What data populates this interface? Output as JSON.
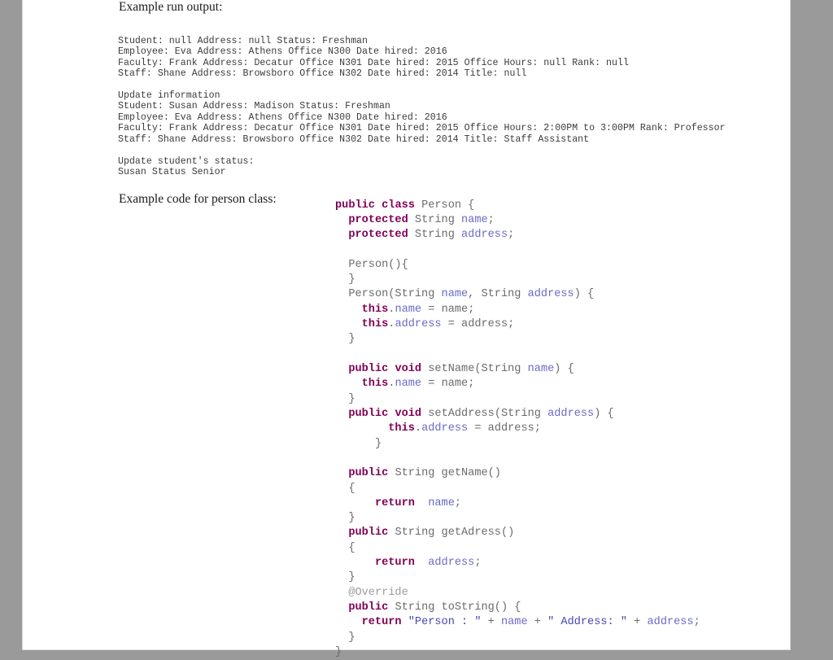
{
  "document": {
    "background_color": "#9a9a9a",
    "page_color": "#ffffff"
  },
  "headings": {
    "run_output": "Example run output:",
    "code": "Example code for person class:"
  },
  "run_output": {
    "lines": [
      "Student: null Address: null Status: Freshman",
      "Employee: Eva Address: Athens Office N300 Date hired: 2016",
      "Faculty: Frank Address: Decatur Office N301 Date hired: 2015 Office Hours: null Rank: null",
      "Staff: Shane Address: Browsboro Office N302 Date hired: 2014 Title: null",
      "",
      "Update information",
      "Student: Susan Address: Madison Status: Freshman",
      "Employee: Eva Address: Athens Office N300 Date hired: 2016",
      "Faculty: Frank Address: Decatur Office N301 Date hired: 2015 Office Hours: 2:00PM to 3:00PM Rank: Professor",
      "Staff: Shane Address: Browsboro Office N302 Date hired: 2014 Title: Staff Assistant",
      "",
      "Update student's status:",
      "Susan Status Senior"
    ]
  },
  "code": {
    "language": "java",
    "class_name": "Person",
    "plain_text": "public class Person {\n  protected String name;\n  protected String address;\n\n  Person(){\n  }\n  Person(String name, String address) {\n    this.name = name;\n    this.address = address;\n  }\n\n  public void setName(String name) {\n    this.name = name;\n  }\n  public void setAddress(String address) {\n        this.address = address;\n      }\n\n  public String getName()\n  {\n      return  name;\n  }\n  public String getAdress()\n  {\n      return  address;\n  }\n  @Override\n  public String toString() {\n    return \"Person : \" + name + \" Address: \" + address;\n  }\n}",
    "colors": {
      "keyword": "#7f0055",
      "field": "#6a6ac6",
      "string": "#4646b4",
      "annotation": "#9d9d9d",
      "plain": "#6b6b6b"
    },
    "lines": [
      [
        {
          "t": "public",
          "c": "kw"
        },
        {
          "t": " ",
          "c": "pln"
        },
        {
          "t": "class",
          "c": "kw"
        },
        {
          "t": " Person {",
          "c": "pln"
        }
      ],
      [
        {
          "t": "  ",
          "c": "pln"
        },
        {
          "t": "protected",
          "c": "kw"
        },
        {
          "t": " String ",
          "c": "pln"
        },
        {
          "t": "name",
          "c": "fld"
        },
        {
          "t": ";",
          "c": "pln"
        }
      ],
      [
        {
          "t": "  ",
          "c": "pln"
        },
        {
          "t": "protected",
          "c": "kw"
        },
        {
          "t": " String ",
          "c": "pln"
        },
        {
          "t": "address",
          "c": "fld"
        },
        {
          "t": ";",
          "c": "pln"
        }
      ],
      [],
      [
        {
          "t": "  Person(){",
          "c": "pln"
        }
      ],
      [
        {
          "t": "  }",
          "c": "pln"
        }
      ],
      [
        {
          "t": "  Person(String ",
          "c": "pln"
        },
        {
          "t": "name",
          "c": "fld"
        },
        {
          "t": ", String ",
          "c": "pln"
        },
        {
          "t": "address",
          "c": "fld"
        },
        {
          "t": ") {",
          "c": "pln"
        }
      ],
      [
        {
          "t": "    ",
          "c": "pln"
        },
        {
          "t": "this",
          "c": "kw"
        },
        {
          "t": ".",
          "c": "pln"
        },
        {
          "t": "name",
          "c": "fld"
        },
        {
          "t": " = name;",
          "c": "pln"
        }
      ],
      [
        {
          "t": "    ",
          "c": "pln"
        },
        {
          "t": "this",
          "c": "kw"
        },
        {
          "t": ".",
          "c": "pln"
        },
        {
          "t": "address",
          "c": "fld"
        },
        {
          "t": " = address;",
          "c": "pln"
        }
      ],
      [
        {
          "t": "  }",
          "c": "pln"
        }
      ],
      [],
      [
        {
          "t": "  ",
          "c": "pln"
        },
        {
          "t": "public",
          "c": "kw"
        },
        {
          "t": " ",
          "c": "pln"
        },
        {
          "t": "void",
          "c": "kw"
        },
        {
          "t": " setName(String ",
          "c": "pln"
        },
        {
          "t": "name",
          "c": "fld"
        },
        {
          "t": ") {",
          "c": "pln"
        }
      ],
      [
        {
          "t": "    ",
          "c": "pln"
        },
        {
          "t": "this",
          "c": "kw"
        },
        {
          "t": ".",
          "c": "pln"
        },
        {
          "t": "name",
          "c": "fld"
        },
        {
          "t": " = name;",
          "c": "pln"
        }
      ],
      [
        {
          "t": "  }",
          "c": "pln"
        }
      ],
      [
        {
          "t": "  ",
          "c": "pln"
        },
        {
          "t": "public",
          "c": "kw"
        },
        {
          "t": " ",
          "c": "pln"
        },
        {
          "t": "void",
          "c": "kw"
        },
        {
          "t": " setAddress(String ",
          "c": "pln"
        },
        {
          "t": "address",
          "c": "fld"
        },
        {
          "t": ") {",
          "c": "pln"
        }
      ],
      [
        {
          "t": "        ",
          "c": "pln"
        },
        {
          "t": "this",
          "c": "kw"
        },
        {
          "t": ".",
          "c": "pln"
        },
        {
          "t": "address",
          "c": "fld"
        },
        {
          "t": " = address;",
          "c": "pln"
        }
      ],
      [
        {
          "t": "      }",
          "c": "pln"
        }
      ],
      [],
      [
        {
          "t": "  ",
          "c": "pln"
        },
        {
          "t": "public",
          "c": "kw"
        },
        {
          "t": " String getName()",
          "c": "pln"
        }
      ],
      [
        {
          "t": "  {",
          "c": "pln"
        }
      ],
      [
        {
          "t": "      ",
          "c": "pln"
        },
        {
          "t": "return",
          "c": "kw"
        },
        {
          "t": "  ",
          "c": "pln"
        },
        {
          "t": "name",
          "c": "fld"
        },
        {
          "t": ";",
          "c": "pln"
        }
      ],
      [
        {
          "t": "  }",
          "c": "pln"
        }
      ],
      [
        {
          "t": "  ",
          "c": "pln"
        },
        {
          "t": "public",
          "c": "kw"
        },
        {
          "t": " String getAdress()",
          "c": "pln"
        }
      ],
      [
        {
          "t": "  {",
          "c": "pln"
        }
      ],
      [
        {
          "t": "      ",
          "c": "pln"
        },
        {
          "t": "return",
          "c": "kw"
        },
        {
          "t": "  ",
          "c": "pln"
        },
        {
          "t": "address",
          "c": "fld"
        },
        {
          "t": ";",
          "c": "pln"
        }
      ],
      [
        {
          "t": "  }",
          "c": "pln"
        }
      ],
      [
        {
          "t": "  ",
          "c": "pln"
        },
        {
          "t": "@Override",
          "c": "ann"
        }
      ],
      [
        {
          "t": "  ",
          "c": "pln"
        },
        {
          "t": "public",
          "c": "kw"
        },
        {
          "t": " String toString() {",
          "c": "pln"
        }
      ],
      [
        {
          "t": "    ",
          "c": "pln"
        },
        {
          "t": "return",
          "c": "kw"
        },
        {
          "t": " ",
          "c": "pln"
        },
        {
          "t": "\"Person : \"",
          "c": "str"
        },
        {
          "t": " + ",
          "c": "pln"
        },
        {
          "t": "name",
          "c": "fld"
        },
        {
          "t": " + ",
          "c": "pln"
        },
        {
          "t": "\" Address: \"",
          "c": "str"
        },
        {
          "t": " + ",
          "c": "pln"
        },
        {
          "t": "address",
          "c": "fld"
        },
        {
          "t": ";",
          "c": "pln"
        }
      ],
      [
        {
          "t": "  }",
          "c": "pln"
        }
      ],
      [
        {
          "t": "}",
          "c": "pln"
        }
      ]
    ]
  }
}
